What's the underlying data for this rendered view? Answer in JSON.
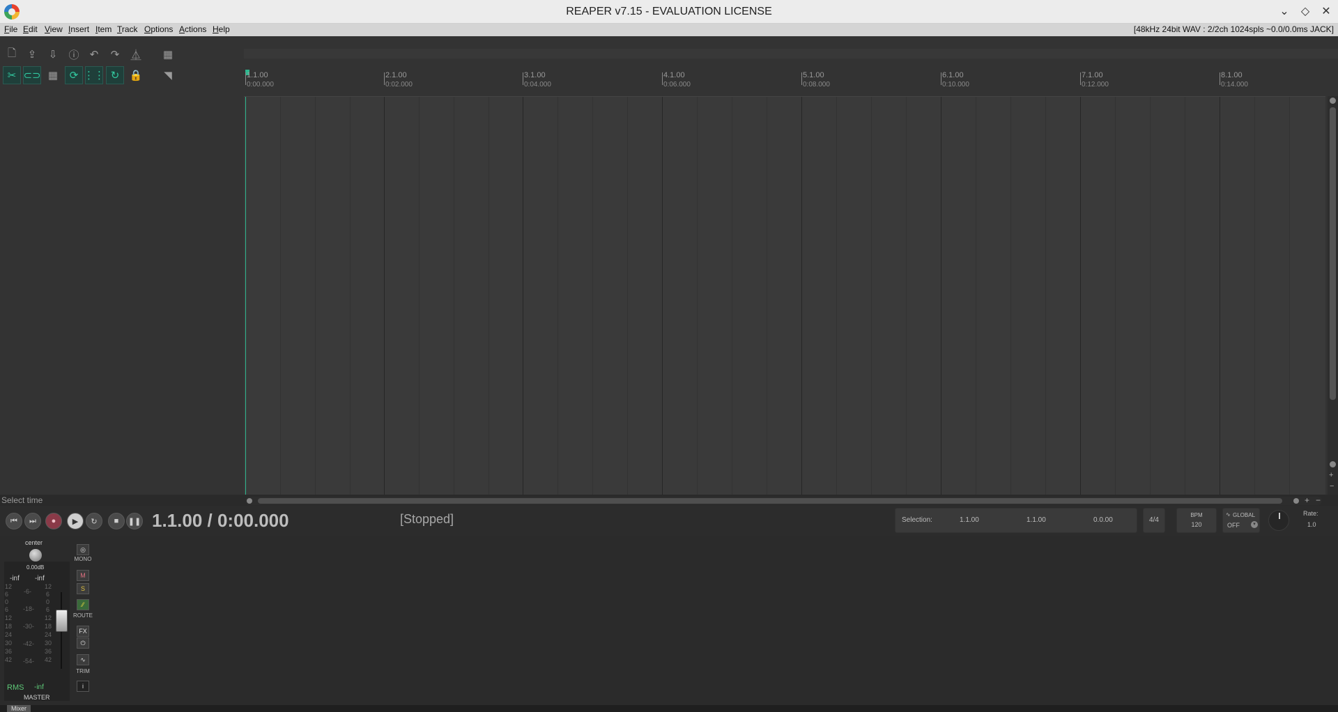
{
  "window": {
    "title": "REAPER v7.15 - EVALUATION LICENSE"
  },
  "menu": {
    "items": [
      "File",
      "Edit",
      "View",
      "Insert",
      "Item",
      "Track",
      "Options",
      "Actions",
      "Help"
    ],
    "status": "[48kHz 24bit WAV : 2/2ch 1024spls ~0.0/0.0ms JACK]"
  },
  "toolbar": {
    "row1": [
      "new-project-icon",
      "open-project-icon",
      "save-project-icon",
      "project-settings-icon",
      "undo-icon",
      "redo-icon",
      "metronome-icon"
    ],
    "row2": [
      "ripple-edit-icon",
      "link-icon",
      "grid-icon",
      "item-grouping-icon",
      "snap-grid-icon",
      "loop-icon",
      "lock-icon"
    ]
  },
  "status_hint": "Select time",
  "ruler": {
    "bars": [
      {
        "bar": "1.1.00",
        "time": "0:00.000"
      },
      {
        "bar": "2.1.00",
        "time": "0:02.000"
      },
      {
        "bar": "3.1.00",
        "time": "0:04.000"
      },
      {
        "bar": "4.1.00",
        "time": "0:06.000"
      },
      {
        "bar": "5.1.00",
        "time": "0:08.000"
      },
      {
        "bar": "6.1.00",
        "time": "0:10.000"
      },
      {
        "bar": "7.1.00",
        "time": "0:12.000"
      },
      {
        "bar": "8.1.00",
        "time": "0:14.000"
      }
    ]
  },
  "transport": {
    "position": "1.1.00 / 0:00.000",
    "state": "[Stopped]",
    "selection_label": "Selection:",
    "selection_start": "1.1.00",
    "selection_end": "1.1.00",
    "selection_length": "0.0.00",
    "time_signature": "4/4",
    "bpm_label": "BPM",
    "bpm": "120",
    "global_label": "GLOBAL",
    "global_state": "OFF",
    "rate_label": "Rate:",
    "rate": "1.0"
  },
  "master": {
    "pan": "center",
    "volume": "0.00dB",
    "peak_left": "-inf",
    "peak_right": "-inf",
    "rms_label": "RMS",
    "rms_value": "-inf",
    "name": "MASTER",
    "mono_label": "MONO",
    "mute_label": "M",
    "solo_label": "S",
    "route_label": "ROUTE",
    "fx_label": "FX",
    "trim_label": "TRIM",
    "info_label": "i",
    "scale_left": [
      "12",
      "6",
      "0",
      "6",
      "12",
      "18",
      "24",
      "30",
      "36",
      "42"
    ],
    "scale_mid": [
      "-6-",
      "-18-",
      "-30-",
      "-42-",
      "-54-"
    ],
    "scale_right": [
      "12",
      "6",
      "0",
      "6",
      "12",
      "18",
      "24",
      "30",
      "36",
      "42"
    ]
  },
  "mixer_tab": "Mixer"
}
